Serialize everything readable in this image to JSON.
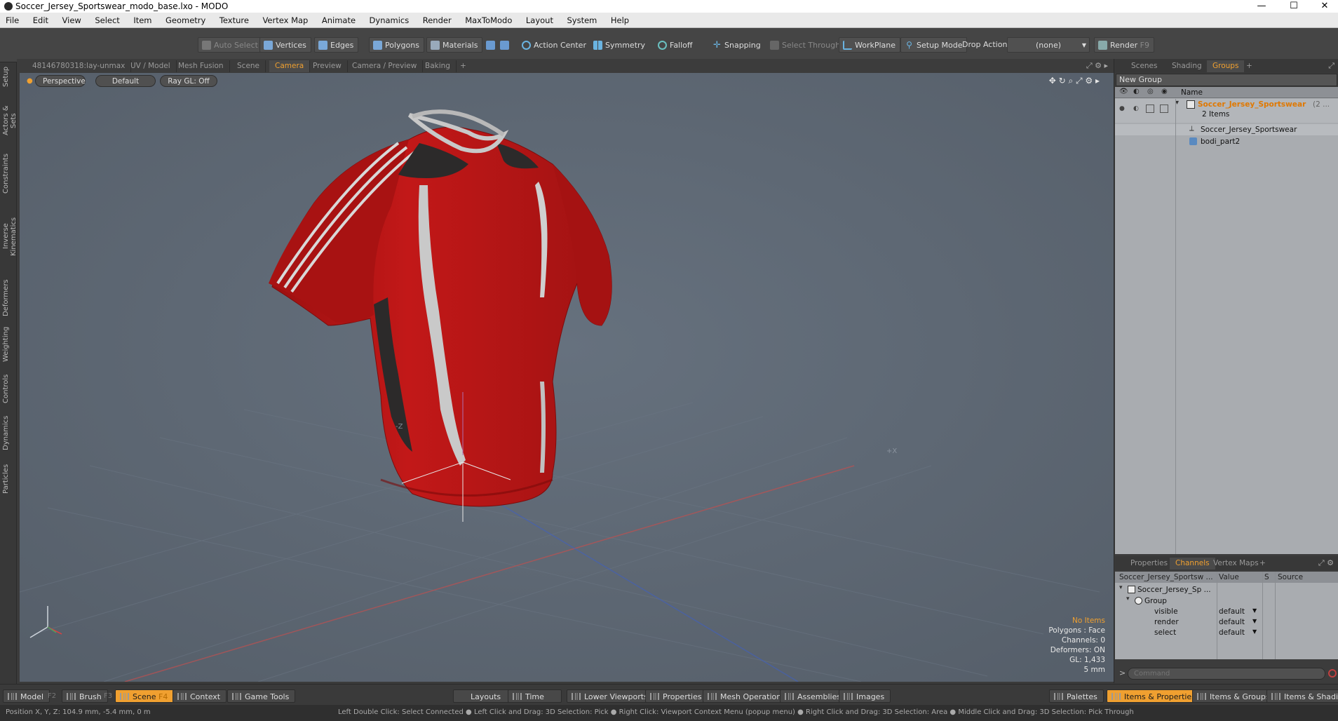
{
  "window": {
    "title": "Soccer_Jersey_Sportswear_modo_base.lxo - MODO",
    "controls": [
      "—",
      "☐",
      "✕"
    ]
  },
  "menu": [
    "File",
    "Edit",
    "View",
    "Select",
    "Item",
    "Geometry",
    "Texture",
    "Vertex Map",
    "Animate",
    "Dynamics",
    "Render",
    "MaxToModo",
    "Layout",
    "System",
    "Help"
  ],
  "toolbar": {
    "auto_select": "Auto Select",
    "vertices": "Vertices",
    "edges": "Edges",
    "polygons": "Polygons",
    "materials": "Materials",
    "action_center": "Action Center",
    "symmetry": "Symmetry",
    "falloff": "Falloff",
    "snapping": "Snapping",
    "select_through": "Select Through",
    "workplane": "WorkPlane",
    "setup_mode": "Setup Mode",
    "drop_action": "Drop Action",
    "drop_value": "(none)",
    "render": "Render",
    "render_key": "F9"
  },
  "left_tabs": [
    "Setup",
    "Actors & Sets",
    "Constraints",
    "Inverse Kinematics",
    "Deformers",
    "Weighting",
    "Controls",
    "Dynamics",
    "Particles"
  ],
  "viewport_tabs": [
    "48146780318:lay-unmax",
    "UV / Model",
    "Mesh Fusion",
    "Scene",
    "Camera",
    "Preview",
    "Camera / Preview",
    "Baking",
    "+"
  ],
  "viewport_opts": {
    "projection": "Perspective",
    "style": "Default",
    "raygl": "Ray GL: Off"
  },
  "viewport_info": {
    "no_items": "No Items",
    "polygons": "Polygons : Face",
    "channels": "Channels: 0",
    "deformers": "Deformers: ON",
    "gl": "GL: 1,433",
    "scale": "5 mm",
    "axis_z": "-Z",
    "axis_x": "+X"
  },
  "right_tabs_top": [
    "Scenes",
    "Shading",
    "Groups",
    "+"
  ],
  "groups": {
    "new_group": "New Group",
    "name_col": "Name",
    "root": "Soccer_Jersey_Sportswear",
    "root_suffix": "(2 ...",
    "count": "2 Items",
    "children": [
      "Soccer_Jersey_Sportswear",
      "bodi_part2"
    ]
  },
  "right_tabs_bottom": [
    "Properties",
    "Channels",
    "Vertex Maps",
    "+"
  ],
  "channels": {
    "col_item": "Soccer_Jersey_Sportsw ...",
    "col_value": "Value",
    "col_s": "S",
    "col_source": "Source",
    "item": "Soccer_Jersey_Sp ...",
    "group": "Group",
    "rows": [
      {
        "name": "visible",
        "value": "default"
      },
      {
        "name": "render",
        "value": "default"
      },
      {
        "name": "select",
        "value": "default"
      }
    ]
  },
  "command_placeholder": "Command",
  "bottom": {
    "model": "Model",
    "model_key": "F2",
    "brush": "Brush",
    "brush_key": "F3",
    "scene": "Scene",
    "scene_key": "F4",
    "context": "Context",
    "game_tools": "Game Tools",
    "layouts": "Layouts",
    "time": "Time",
    "lower_viewports": "Lower Viewports",
    "properties": "Properties",
    "mesh_operations": "Mesh Operations",
    "assemblies": "Assemblies",
    "images": "Images",
    "palettes": "Palettes",
    "items_properties": "Items & Properties",
    "items_groups": "Items & Groups",
    "items_shading": "Items & Shading"
  },
  "status": {
    "position": "Position X, Y, Z:  104.9 mm, -5.4 mm, 0 m",
    "hint": "Left Double Click: Select Connected ● Left Click and Drag: 3D Selection: Pick ● Right Click: Viewport Context Menu (popup menu) ● Right Click and Drag: 3D Selection: Area ● Middle Click and Drag: 3D Selection: Pick Through"
  },
  "colors": {
    "accent": "#f0a030",
    "viewport_bg": "#5f6b78",
    "jersey_red": "#b81515",
    "jersey_dark": "#2c2a2a",
    "jersey_stripe": "#c9c9c9"
  }
}
